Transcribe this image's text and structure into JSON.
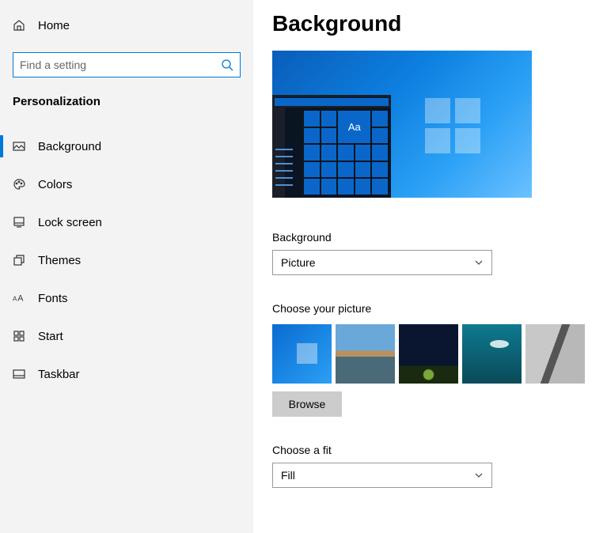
{
  "sidebar": {
    "home_label": "Home",
    "search_placeholder": "Find a setting",
    "category": "Personalization",
    "items": [
      {
        "label": "Background",
        "icon": "picture-icon",
        "active": true
      },
      {
        "label": "Colors",
        "icon": "palette-icon"
      },
      {
        "label": "Lock screen",
        "icon": "lockscreen-icon"
      },
      {
        "label": "Themes",
        "icon": "themes-icon"
      },
      {
        "label": "Fonts",
        "icon": "fonts-icon"
      },
      {
        "label": "Start",
        "icon": "start-icon"
      },
      {
        "label": "Taskbar",
        "icon": "taskbar-icon"
      }
    ]
  },
  "main": {
    "title": "Background",
    "preview_sample_text": "Aa",
    "bg_label": "Background",
    "bg_value": "Picture",
    "choose_picture_label": "Choose your picture",
    "browse_label": "Browse",
    "fit_label": "Choose a fit",
    "fit_value": "Fill"
  }
}
